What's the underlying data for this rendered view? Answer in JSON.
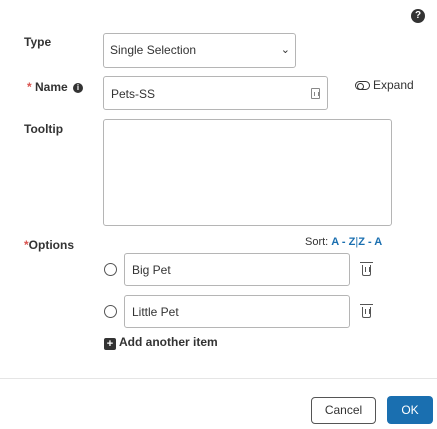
{
  "help": {
    "glyph": "?"
  },
  "type": {
    "label": "Type",
    "selected": "Single Selection",
    "chevron": "⌄"
  },
  "name": {
    "required_marker": "*",
    "label": "Name",
    "info_glyph": "i",
    "value": "Pets-SS",
    "expand_label": "Expand"
  },
  "tooltip": {
    "label": "Tooltip",
    "value": ""
  },
  "options": {
    "required_marker": "*",
    "label": "Options",
    "sort": {
      "prefix": "Sort:",
      "az": "A - Z",
      "divider": "|",
      "za": "Z - A"
    },
    "items": [
      {
        "value": "Big Pet"
      },
      {
        "value": "Little Pet"
      }
    ],
    "add_label": "Add another item",
    "add_glyph": "+"
  },
  "footer": {
    "cancel_label": "Cancel",
    "ok_label": "OK"
  },
  "colors": {
    "primary": "#1a6fb0",
    "required": "#d9534f",
    "border": "#b5b5b5"
  }
}
